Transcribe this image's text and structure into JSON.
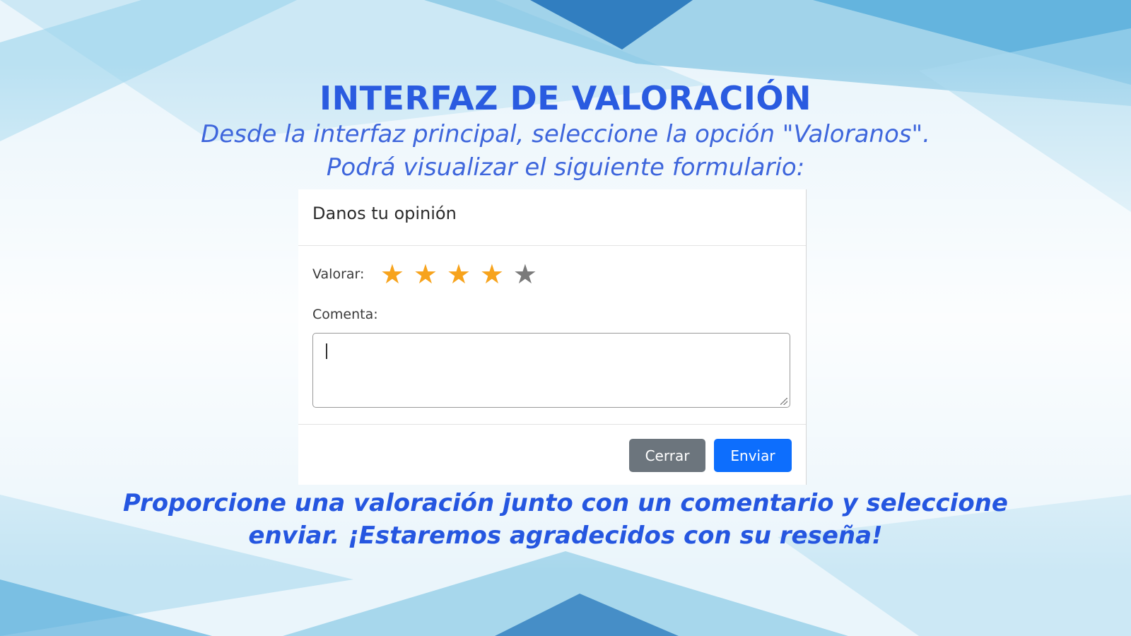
{
  "page": {
    "title": "INTERFAZ DE VALORACIÓN",
    "subtitle_line1": "Desde la interfaz principal, seleccione la opción \"Valoranos\".",
    "subtitle_line2": "Podrá visualizar el siguiente formulario:",
    "footer_line1": "Proporcione una valoración junto con un comentario y seleccione",
    "footer_line2": "enviar. ¡Estaremos agradecidos con su reseña!"
  },
  "modal": {
    "title": "Danos tu opinión",
    "rating_label": "Valorar:",
    "rating": {
      "value": 4,
      "max": 5
    },
    "comment_label": "Comenta:",
    "comment_value": "",
    "close_label": "Cerrar",
    "send_label": "Enviar"
  },
  "colors": {
    "heading": "#2a5be0",
    "star_active": "#f7a31c",
    "star_inactive": "#7a7a7a",
    "button_close": "#6c757d",
    "button_send": "#0d6efd"
  }
}
